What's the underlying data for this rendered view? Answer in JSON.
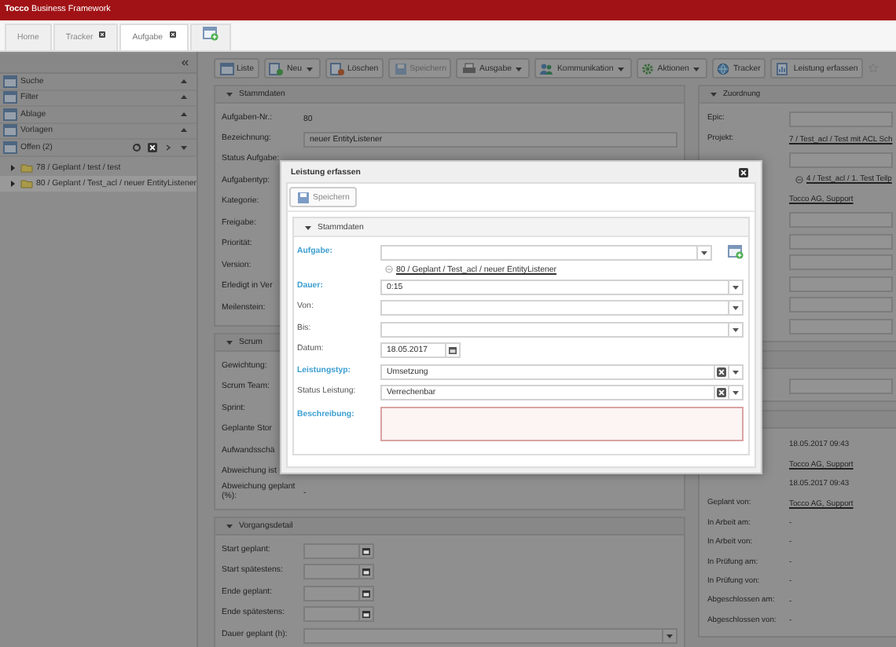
{
  "header": {
    "title": "**Tocco** Business Framework"
  },
  "tabs": [
    {
      "label": "Home",
      "selected": false,
      "closable": false
    },
    {
      "label": "Tracker",
      "selected": false,
      "closable": true
    },
    {
      "label": "Aufgabe",
      "selected": true,
      "closable": true
    }
  ],
  "sidebar": {
    "sections": [
      {
        "label": "Suche"
      },
      {
        "label": "Filter"
      },
      {
        "label": "Ablage"
      },
      {
        "label": "Vorlagen"
      }
    ],
    "open_list": {
      "label": "Offen (2)",
      "items": [
        {
          "label": "78 / Geplant / test / test",
          "selected": false
        },
        {
          "label": "80 / Geplant / Test_acl / neuer EntityListener",
          "selected": true
        }
      ]
    }
  },
  "toolbar": [
    {
      "label": "Liste",
      "dropdown": false,
      "disabled": false
    },
    {
      "label": "Neu",
      "dropdown": true,
      "disabled": false
    },
    {
      "label": "Löschen",
      "dropdown": false,
      "disabled": false
    },
    {
      "label": "Speichern",
      "dropdown": false,
      "disabled": true
    },
    {
      "label": "Ausgabe",
      "dropdown": true,
      "disabled": false
    },
    {
      "label": "Kommunikation",
      "dropdown": true,
      "disabled": false
    },
    {
      "label": "Aktionen",
      "dropdown": true,
      "disabled": false
    },
    {
      "label": "Tracker",
      "dropdown": false,
      "disabled": false
    },
    {
      "label": "Leistung erfassen",
      "dropdown": false,
      "disabled": false
    }
  ],
  "detail": {
    "left_sections": [
      {
        "title": "Stammdaten",
        "expanded": true,
        "fields": [
          {
            "label": "Aufgaben-Nr.:",
            "kind": "text",
            "value": "80"
          },
          {
            "label": "Bezeichnung:",
            "kind": "input",
            "value": "neuer EntityListener"
          },
          {
            "label": "Status Aufgabe:"
          },
          {
            "label": "Aufgabentyp:"
          },
          {
            "label": "Kategorie:"
          },
          {
            "label": "Freigabe:"
          },
          {
            "label": "Priorität:"
          },
          {
            "label": "Version:"
          },
          {
            "label": "Erledigt in Ver"
          },
          {
            "label": "Meilenstein:"
          }
        ]
      },
      {
        "title": "Scrum",
        "expanded": true,
        "fields": [
          {
            "label": "Gewichtung:"
          },
          {
            "label": "Scrum Team:"
          },
          {
            "label": "Sprint:"
          },
          {
            "label": "Geplante Stor"
          },
          {
            "label": "Aufwandsschä"
          },
          {
            "label": "Abweichung ist"
          },
          {
            "label": "Abweichung geplant (%):",
            "kind": "text",
            "value": "-"
          }
        ]
      },
      {
        "title": "Vorgangsdetail",
        "expanded": true,
        "fields": [
          {
            "label": "Start geplant:",
            "kind": "date"
          },
          {
            "label": "Start spätestens:",
            "kind": "date"
          },
          {
            "label": "Ende geplant:",
            "kind": "date"
          },
          {
            "label": "Ende spätestens:",
            "kind": "date"
          },
          {
            "label": "Dauer geplant (h):",
            "kind": "combo"
          }
        ]
      }
    ],
    "right_sections": [
      {
        "title": "Zuordnung",
        "expanded": true,
        "fields": [
          {
            "label": "Epic:",
            "kind": "input"
          },
          {
            "label": "Projekt:",
            "kind": "link",
            "value": "7 / Test_acl / Test mit ACL Sch"
          },
          {
            "kind": "input"
          },
          {
            "kind": "sublink",
            "value": "4 / Test_acl / 1. Test Teilp"
          },
          {
            "kind": "link",
            "value": "Tocco AG, Support"
          },
          {
            "kind": "input"
          },
          {
            "kind": "input"
          },
          {
            "kind": "input"
          },
          {
            "kind": "input"
          },
          {
            "kind": "input"
          },
          {
            "kind": "input"
          }
        ]
      },
      {
        "expanded": true,
        "fields": [
          {
            "kind": "input"
          }
        ]
      },
      {
        "expanded": true,
        "fields": [
          {
            "kind": "text",
            "value": "18.05.2017 09:43"
          },
          {
            "kind": "link",
            "value": "Tocco AG, Support"
          },
          {
            "kind": "text",
            "value": "18.05.2017 09:43"
          },
          {
            "label": "Geplant von:",
            "kind": "link",
            "value": "Tocco AG, Support"
          },
          {
            "label": "In Arbeit am:",
            "kind": "text",
            "value": "-"
          },
          {
            "label": "In Arbeit von:",
            "kind": "text",
            "value": "-"
          },
          {
            "label": "In Prüfung am:",
            "kind": "text",
            "value": "-"
          },
          {
            "label": "In Prüfung von:",
            "kind": "text",
            "value": "-"
          },
          {
            "label": "Abgeschlossen am:",
            "kind": "text",
            "value": "-"
          },
          {
            "label": "Abgeschlossen von:",
            "kind": "text",
            "value": "-"
          }
        ]
      }
    ]
  },
  "dialog": {
    "title": "Leistung erfassen",
    "save_button": "Speichern",
    "section": {
      "title": "Stammdaten",
      "expanded": true,
      "fields": [
        {
          "label": "Aufgabe:",
          "required": true,
          "kind": "combo-add"
        },
        {
          "kind": "sublink",
          "value": "80 / Geplant / Test_acl / neuer EntityListener"
        },
        {
          "label": "Dauer:",
          "required": true,
          "kind": "combo",
          "value": "0:15"
        },
        {
          "label": "Von:",
          "required": false,
          "kind": "combo"
        },
        {
          "label": "Bis:",
          "required": false,
          "kind": "combo"
        },
        {
          "label": "Datum:",
          "required": false,
          "kind": "date",
          "value": "18.05.2017"
        },
        {
          "label": "Leistungstyp:",
          "required": true,
          "kind": "clear-combo",
          "value": "Umsetzung"
        },
        {
          "label": "Status Leistung:",
          "required": false,
          "kind": "clear-combo",
          "value": "Verrechenbar"
        },
        {
          "label": "Beschreibung:",
          "required": true,
          "kind": "textarea",
          "invalid": true
        }
      ]
    }
  }
}
